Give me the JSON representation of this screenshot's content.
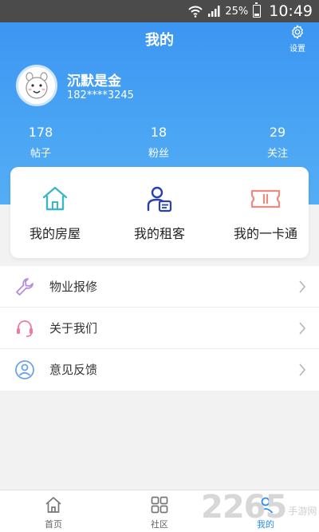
{
  "status_bar": {
    "battery": "25%",
    "time": "10:49"
  },
  "header": {
    "title": "我的",
    "settings_label": "设置"
  },
  "profile": {
    "name": "沉默是金",
    "phone": "182****3245"
  },
  "stats": [
    {
      "value": "178",
      "label": "帖子"
    },
    {
      "value": "18",
      "label": "粉丝"
    },
    {
      "value": "29",
      "label": "关注"
    }
  ],
  "quick_actions": [
    {
      "label": "我的房屋",
      "icon": "house-icon"
    },
    {
      "label": "我的租客",
      "icon": "tenant-icon"
    },
    {
      "label": "我的一卡通",
      "icon": "card-icon"
    }
  ],
  "menu": [
    {
      "label": "物业报修",
      "icon": "wrench-icon"
    },
    {
      "label": "关于我们",
      "icon": "headset-icon"
    },
    {
      "label": "意见反馈",
      "icon": "user-circle-icon"
    }
  ],
  "tabbar": [
    {
      "label": "首页",
      "icon": "home-icon",
      "active": false
    },
    {
      "label": "社区",
      "icon": "grid-icon",
      "active": false
    },
    {
      "label": "我的",
      "icon": "profile-icon",
      "active": true
    }
  ],
  "watermark": {
    "number": "2265",
    "text": "手游网"
  },
  "colors": {
    "header_blue": "#3c96f2",
    "active_tab": "#2d8cf0"
  }
}
